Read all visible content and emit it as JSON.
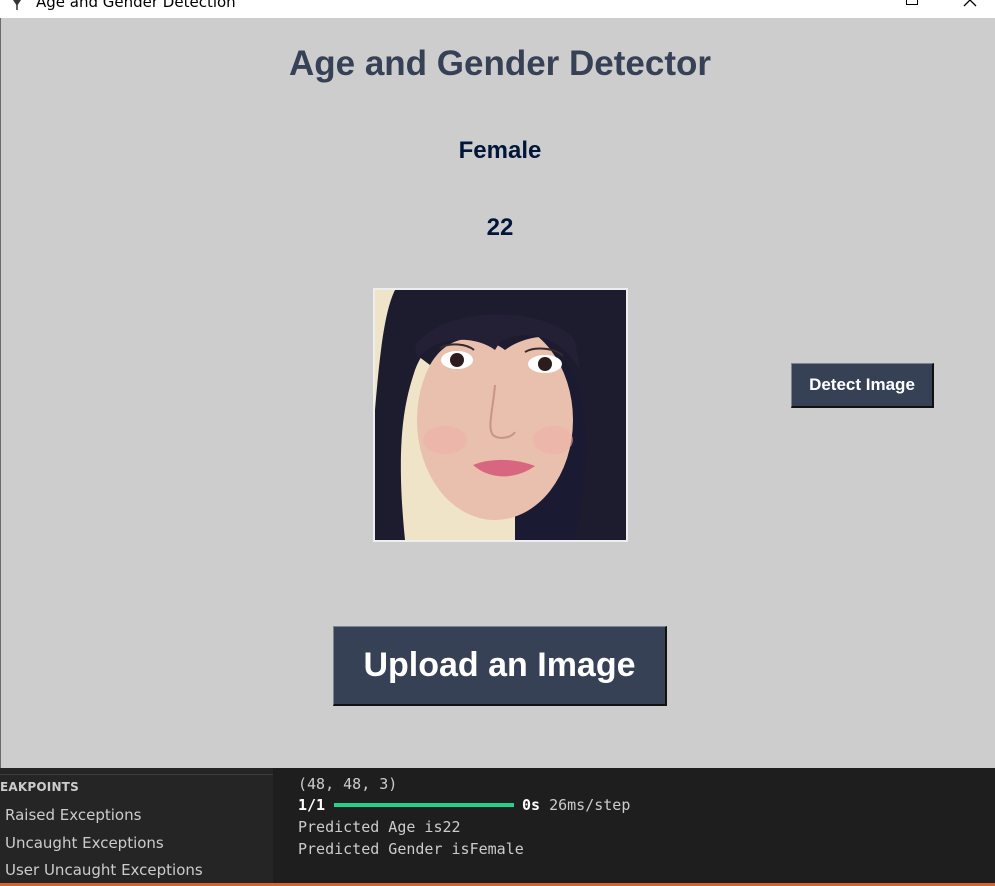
{
  "window": {
    "title": "Age and Gender Detection"
  },
  "app": {
    "heading": "Age and Gender Detector",
    "gender": "Female",
    "age": "22",
    "detect_button": "Detect Image",
    "upload_button": "Upload an Image"
  },
  "debug_sidebar": {
    "header": "EAKPOINTS",
    "items": [
      "Raised Exceptions",
      "Uncaught Exceptions",
      "User Uncaught Exceptions"
    ]
  },
  "terminal": {
    "shape_line": "(48, 48, 3)",
    "progress_step": "1/1",
    "progress_fraction": 1.0,
    "progress_time": "0s",
    "progress_rate": "26ms/step",
    "age_line": "Predicted Age is22",
    "gender_line": "Predicted Gender isFemale"
  },
  "colors": {
    "app_background": "#cdcdcd",
    "heading": "#364156",
    "label": "#011638",
    "button": "#364156",
    "progress_bar": "#23d18b"
  }
}
